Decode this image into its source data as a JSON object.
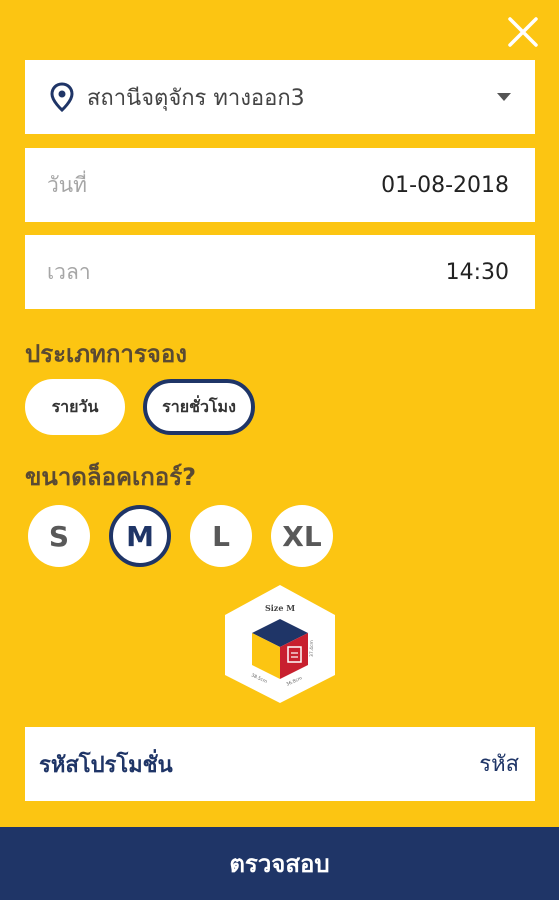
{
  "station": {
    "name": "สถานีจตุจักร ทางออก3"
  },
  "date": {
    "label": "วันที่",
    "value": "01-08-2018"
  },
  "time": {
    "label": "เวลา",
    "value": "14:30"
  },
  "booking_type": {
    "title": "ประเภทการจอง",
    "options": [
      {
        "label": "รายวัน",
        "selected": false
      },
      {
        "label": "รายชั่วโมง",
        "selected": true
      }
    ]
  },
  "locker_size": {
    "title": "ขนาดล็อคเกอร์?",
    "options": [
      {
        "label": "S",
        "selected": false
      },
      {
        "label": "M",
        "selected": true
      },
      {
        "label": "L",
        "selected": false
      },
      {
        "label": "XL",
        "selected": false
      }
    ],
    "illustration": {
      "size_label": "Size M",
      "dim_left": "38.5cm",
      "dim_bottom": "36.8cm",
      "dim_right": "37.4cm"
    }
  },
  "promo": {
    "label": "รหัสโปรโมชั่น",
    "placeholder": "รหัส"
  },
  "submit": {
    "label": "ตรวจสอบ"
  },
  "colors": {
    "background": "#FCC512",
    "accent": "#1F3567",
    "card": "#FFFFFF"
  }
}
